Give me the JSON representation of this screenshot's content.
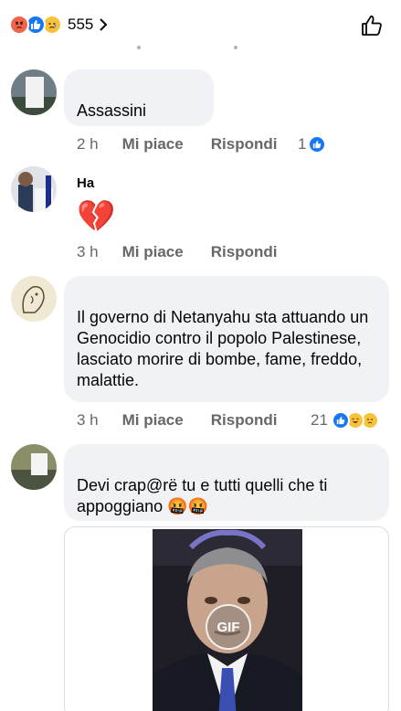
{
  "header": {
    "reaction_count": "555",
    "reactions": [
      "angry",
      "like",
      "sad"
    ]
  },
  "comments": [
    {
      "name": "",
      "text": "Assassini",
      "time": "2 h",
      "like_label": "Mi piace",
      "reply_label": "Rispondi",
      "reaction_count": "1",
      "reactions": [
        "like"
      ]
    },
    {
      "name": "Ha",
      "text": "💔",
      "time": "3 h",
      "like_label": "Mi piace",
      "reply_label": "Rispondi"
    },
    {
      "name": "",
      "text": "Il governo di Netanyahu sta attuando un Genocidio contro il popolo Palestinese, lasciato morire di bombe, fame, freddo, malattie.",
      "time": "3 h",
      "like_label": "Mi piace",
      "reply_label": "Rispondi",
      "reaction_count": "21",
      "reactions": [
        "like",
        "haha",
        "sad"
      ]
    },
    {
      "name": "",
      "text": "Devi crap@rë tu e tutti quelli che ti appoggiano 🤬🤬",
      "gif_label": "GIF"
    }
  ],
  "colors": {
    "facebook_blue": "#1877f2",
    "bubble_bg": "#f0f2f5",
    "meta_gray": "#65676b"
  },
  "icons": [
    "angry-reaction-icon",
    "like-reaction-icon",
    "sad-reaction-icon",
    "haha-reaction-icon",
    "chevron-right-icon",
    "thumbs-up-icon",
    "broken-heart-emoji"
  ]
}
